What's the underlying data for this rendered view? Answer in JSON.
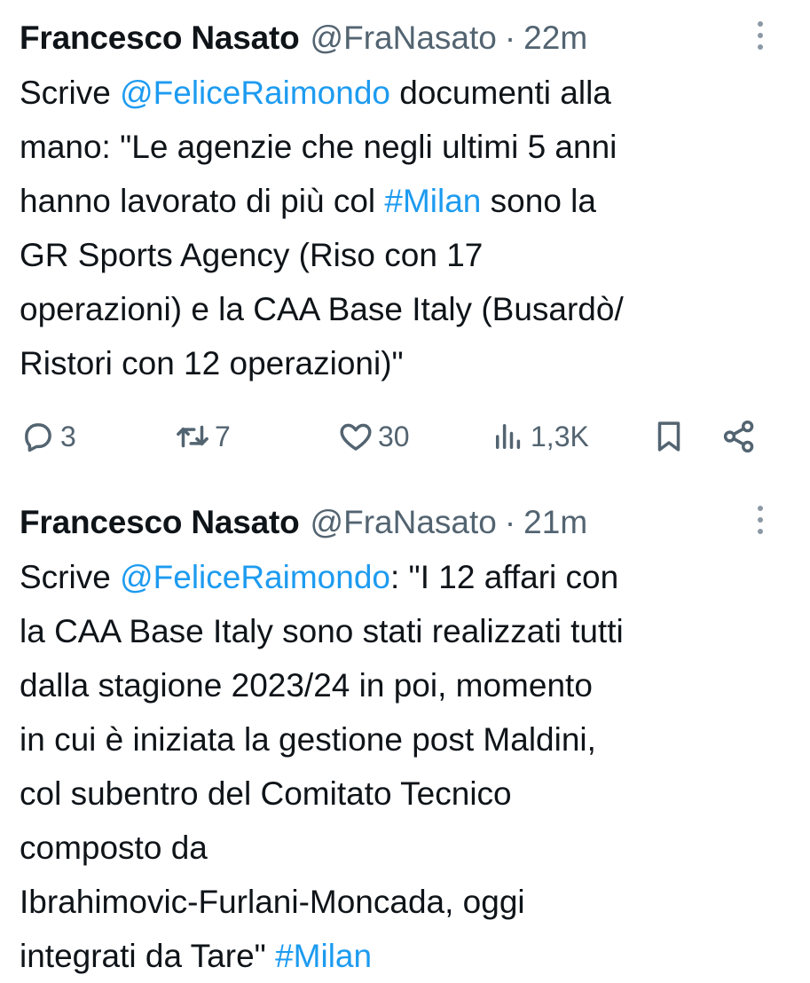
{
  "colors": {
    "text": "#0f1419",
    "secondary": "#536471",
    "link": "#1d9bf0",
    "background": "#ffffff"
  },
  "icons": {
    "reply": "speech-bubble-icon",
    "retweet": "retweet-arrows-icon",
    "like": "heart-icon",
    "views": "bar-chart-icon",
    "bookmark": "bookmark-icon",
    "share": "share-nodes-icon",
    "more": "vertical-ellipsis-icon"
  },
  "tweets": [
    {
      "author": "Francesco Nasato",
      "handle": "@FraNasato",
      "separator": "·",
      "time": "22m",
      "lines": [
        [
          "Scrive ",
          "@FeliceRaimondo",
          " documenti alla"
        ],
        [
          "mano: \"Le agenzie che negli ultimi 5 anni"
        ],
        [
          "hanno lavorato di più col ",
          "#Milan",
          " sono la"
        ],
        [
          "GR Sports Agency (Riso con 17"
        ],
        [
          "operazioni) e la CAA Base Italy (Busardò/"
        ],
        [
          "Ristori con 12 operazioni)\""
        ]
      ],
      "stats": {
        "replies": "3",
        "retweets": "7",
        "likes": "30",
        "views": "1,3K"
      }
    },
    {
      "author": "Francesco Nasato",
      "handle": "@FraNasato",
      "separator": "·",
      "time": "21m",
      "lines": [
        [
          "Scrive ",
          "@FeliceRaimondo",
          ": \"I 12 affari con"
        ],
        [
          "la CAA Base Italy sono stati realizzati tutti"
        ],
        [
          "dalla stagione 2023/24 in poi, momento"
        ],
        [
          "in cui è iniziata la gestione post Maldini,"
        ],
        [
          "col subentro del Comitato Tecnico"
        ],
        [
          "composto da"
        ],
        [
          "Ibrahimovic-Furlani-Moncada, oggi"
        ],
        [
          "integrati da Tare\" ",
          "#Milan"
        ]
      ]
    }
  ]
}
